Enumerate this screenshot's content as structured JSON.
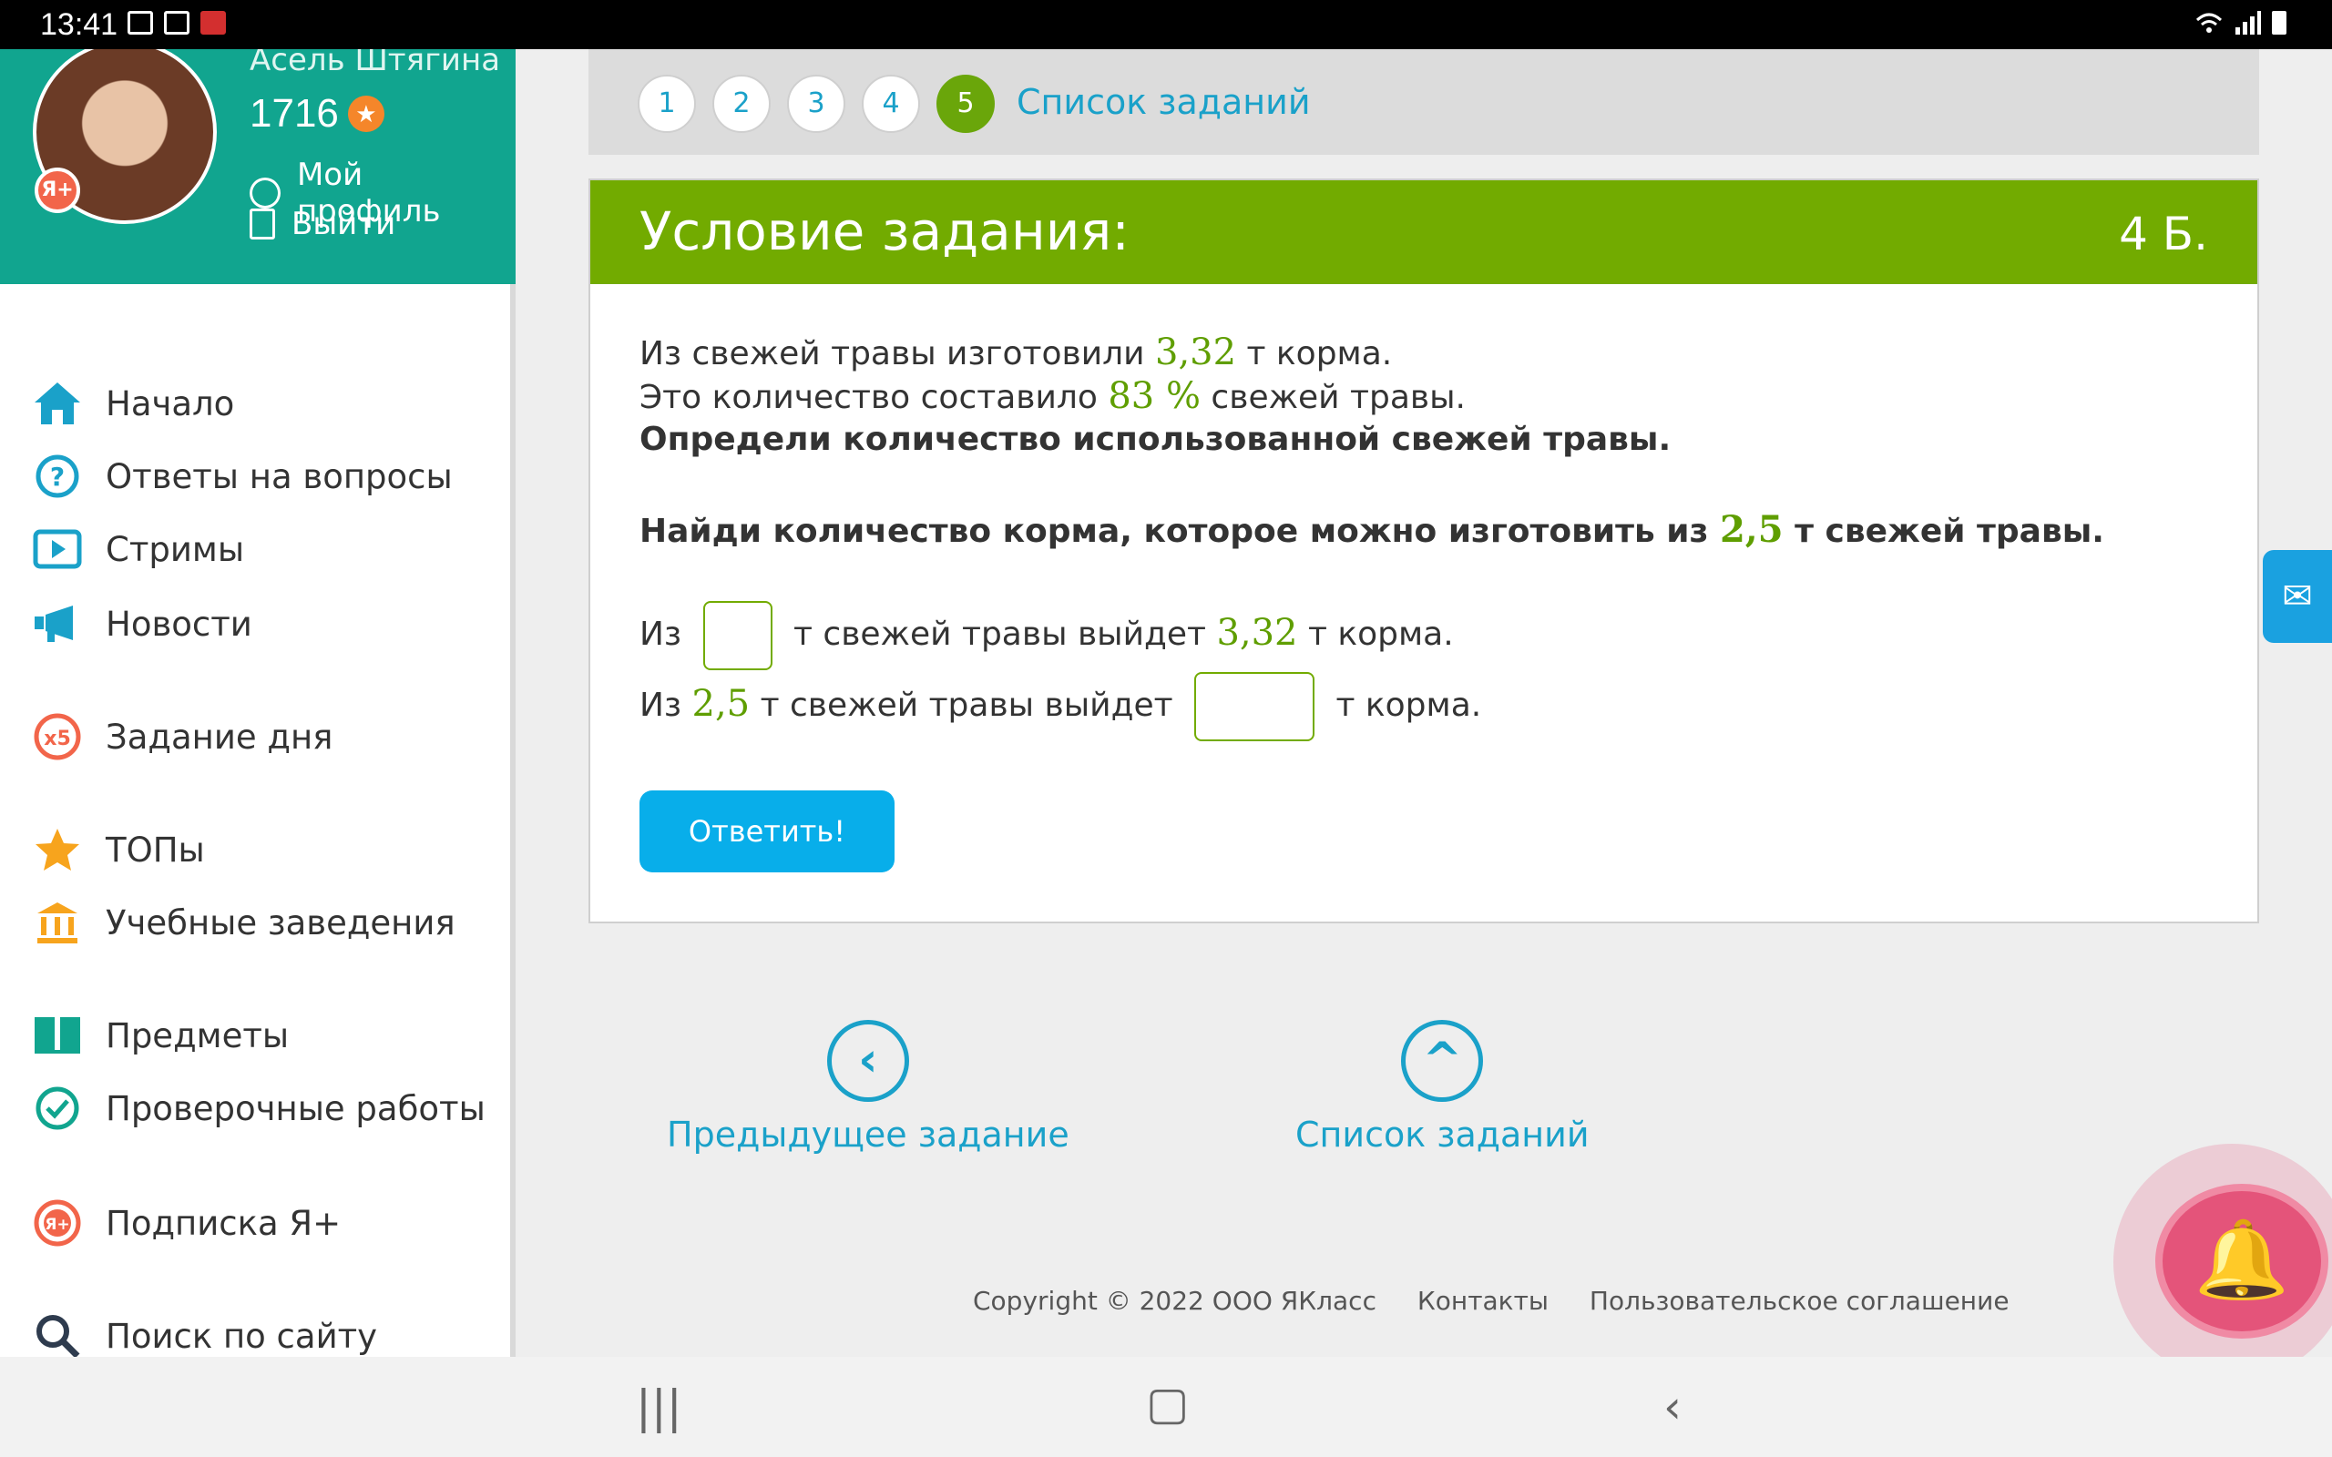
{
  "status_bar": {
    "time": "13:41"
  },
  "profile": {
    "name": "Асель Штягина",
    "points": "1716",
    "badge": "Я+",
    "profile_link": "Мой профиль",
    "logout_link": "Выйти"
  },
  "sidebar": {
    "items": [
      {
        "label": "Начало",
        "icon": "home-icon"
      },
      {
        "label": "Ответы на вопросы",
        "icon": "question-icon"
      },
      {
        "label": "Стримы",
        "icon": "play-icon"
      },
      {
        "label": "Новости",
        "icon": "megaphone-icon"
      },
      {
        "label": "Задание дня",
        "icon": "x5-icon",
        "icon_text": "x5"
      },
      {
        "label": "ТОПы",
        "icon": "star-icon"
      },
      {
        "label": "Учебные заведения",
        "icon": "institution-icon"
      },
      {
        "label": "Предметы",
        "icon": "book-icon"
      },
      {
        "label": "Проверочные работы",
        "icon": "check-circle-icon"
      },
      {
        "label": "Подписка Я+",
        "icon": "yaplus-icon",
        "icon_text": "Я+"
      },
      {
        "label": "Поиск по сайту",
        "icon": "search-icon"
      }
    ]
  },
  "tasks": {
    "numbers": [
      "1",
      "2",
      "3",
      "4",
      "5"
    ],
    "active": "5",
    "list_link": "Список заданий"
  },
  "task_card": {
    "title": "Условие задания:",
    "points": "4 Б.",
    "line1_pre": "Из свежей травы изготовили ",
    "line1_num": "3,32",
    "line1_post": " т корма.",
    "line2_pre": "Это количество составило ",
    "line2_num": "83 %",
    "line2_post": " свежей травы.",
    "line3": "Определи количество использованной свежей травы.",
    "line4_pre": "Найди количество корма, которое можно изготовить из ",
    "line4_num": "2,5",
    "line4_post": " т свежей травы.",
    "row1_pre": "Из",
    "row1_mid": "т свежей травы выйдет ",
    "row1_num": "3,32",
    "row1_post": " т корма.",
    "row2_pre": "Из ",
    "row2_num": "2,5",
    "row2_mid": " т свежей травы выйдет",
    "row2_post": "т корма.",
    "input1_value": "",
    "input2_value": "",
    "answer_button": "Ответить!"
  },
  "bottom_nav": {
    "prev": "Предыдущее задание",
    "list": "Список заданий"
  },
  "footer": {
    "copyright": "Copyright © 2022 ООО ЯКласс",
    "contacts": "Контакты",
    "agreement": "Пользовательское соглашение"
  },
  "colors": {
    "sidebar_header": "#11a58f",
    "card_header": "#72ab00",
    "link": "#1aa1c9",
    "button": "#08aeea",
    "number": "#5f9e00"
  }
}
